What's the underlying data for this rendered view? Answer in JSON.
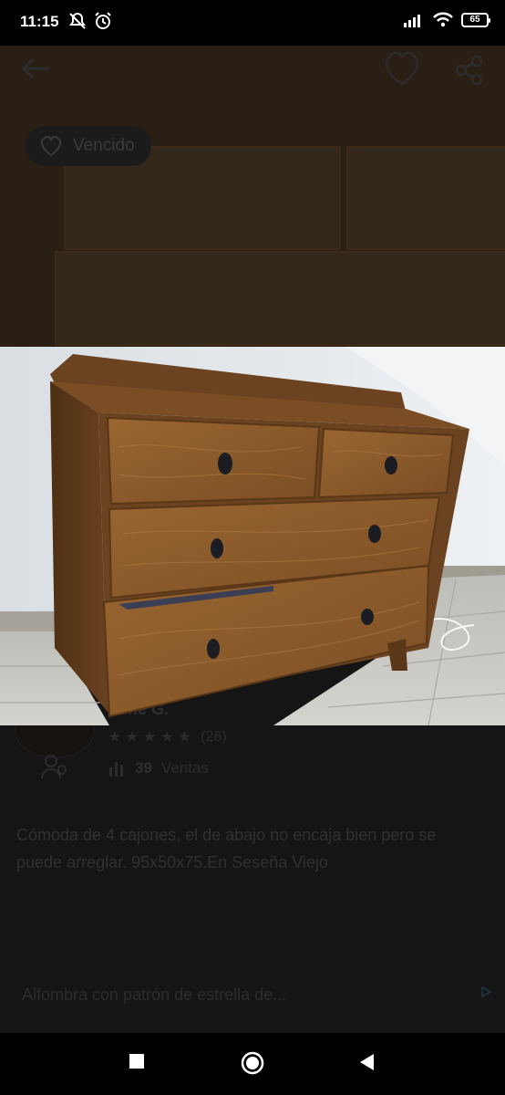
{
  "status_bar": {
    "time": "11:15",
    "battery": "65"
  },
  "listing": {
    "status_badge": "Vencido"
  },
  "seller": {
    "name": "Irene G.",
    "rating_count": "(26)",
    "sales_count": "39",
    "sales_label": "Ventas"
  },
  "description": "Cómoda de 4 cajones, el de abajo no encaja bien pero se puede arreglar. 95x50x75.En Seseña Viejo",
  "ad": {
    "text": "Alfombra con patrón de estrella de..."
  },
  "colors": {
    "background": "#000000",
    "wood": "#8a5a2b",
    "wall": "#e6ebf0",
    "floor": "#c9c8c3"
  }
}
